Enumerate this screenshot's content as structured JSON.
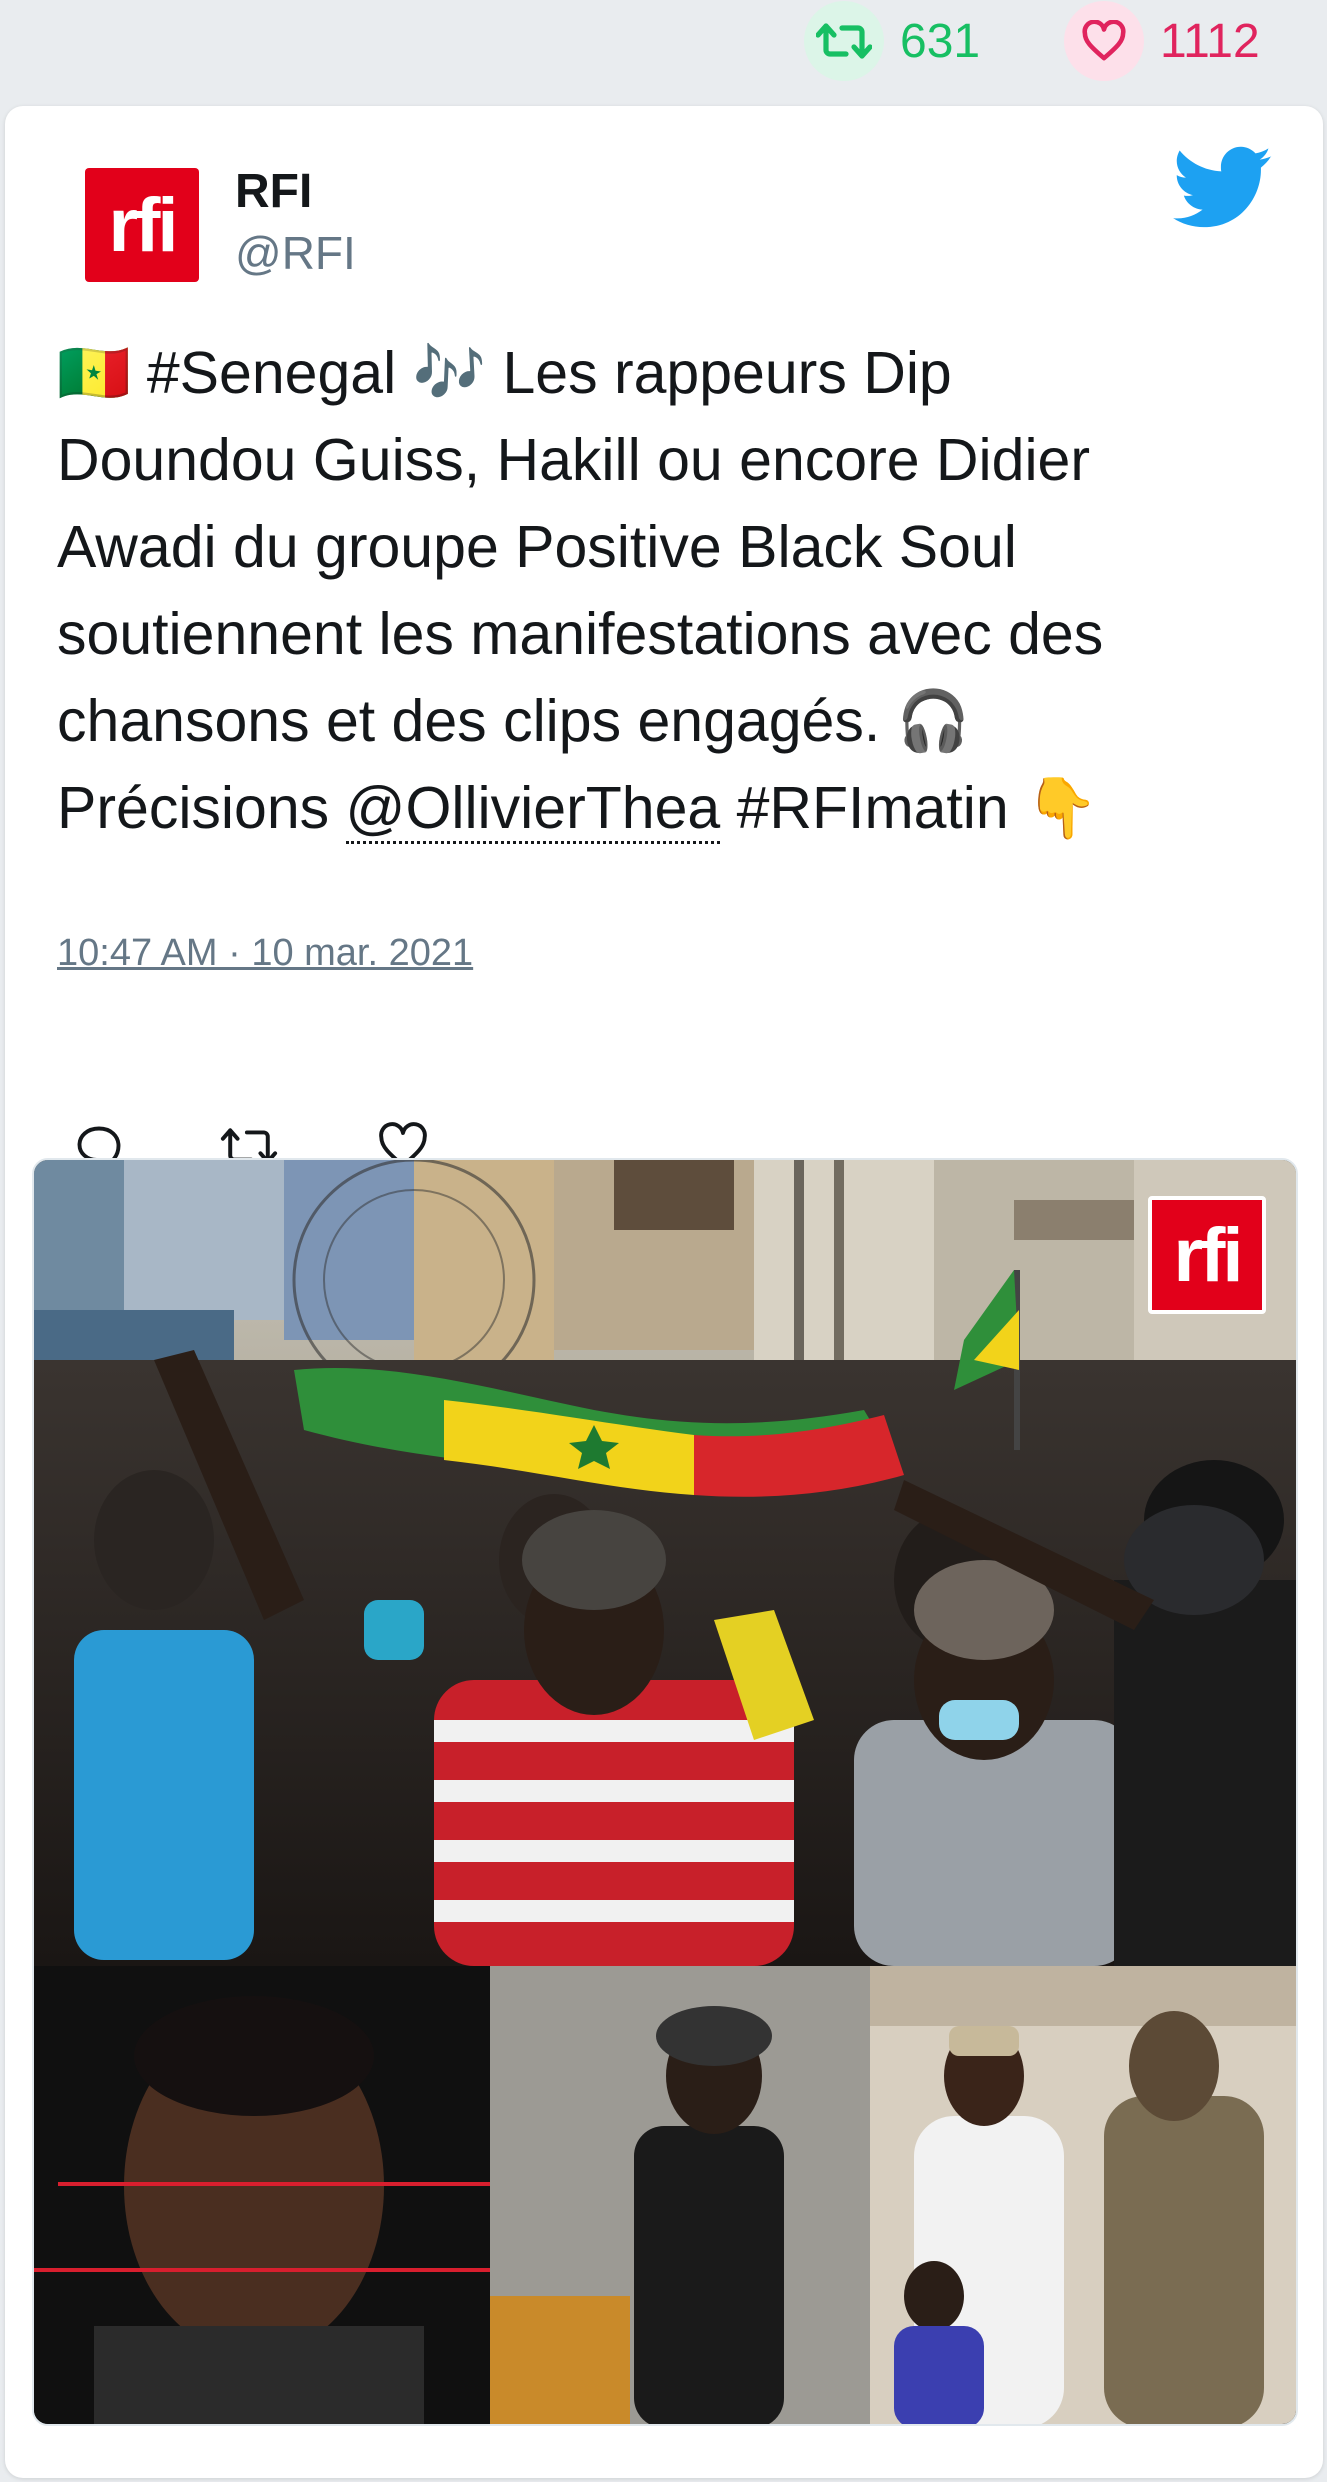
{
  "top_stats": {
    "retweet_count": "631",
    "like_count": "1112",
    "retweet_icon": "retweet-icon",
    "like_icon": "heart-icon"
  },
  "tweet": {
    "author_name": "RFI",
    "author_handle": "@RFI",
    "avatar_label": "rfi",
    "text_lines": [
      "🇸🇳 #Senegal 🎶 Les rappeurs Dip",
      "Doundou Guiss, Hakill ou encore Didier",
      "Awadi du groupe Positive Black Soul",
      "soutiennent les manifestations avec des",
      "chansons et des clips engagés. 🎧",
      "Précisions "
    ],
    "mention": "@OllivierThea",
    "text_tail": " #RFImatin 👇",
    "timestamp": "10:47 AM · 10 mar. 2021",
    "media_logo": "rfi"
  },
  "colors": {
    "retweet_green": "#17bf63",
    "like_red": "#e0245e",
    "twitter_blue": "#1da1f2",
    "rfi_red": "#e2001a"
  }
}
